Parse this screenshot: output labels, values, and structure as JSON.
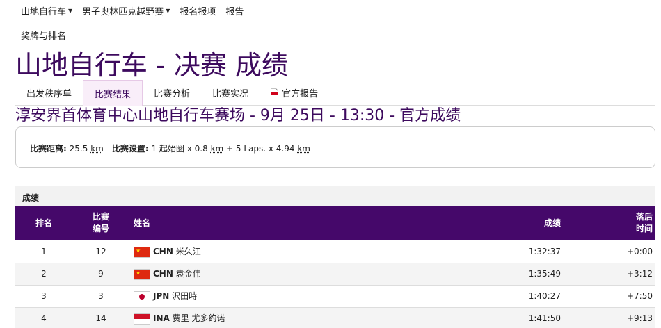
{
  "topnav": {
    "items": [
      {
        "label": "山地自行车",
        "dropdown": true
      },
      {
        "label": "男子奥林匹克越野赛",
        "dropdown": true
      },
      {
        "label": "报名报项",
        "dropdown": false
      },
      {
        "label": "报告",
        "dropdown": false
      }
    ],
    "sub_item": "奖牌与排名"
  },
  "page_title": "山地自行车 - 决赛 成绩",
  "tabs": [
    {
      "label": "出发秩序单",
      "active": false
    },
    {
      "label": "比赛结果",
      "active": true
    },
    {
      "label": "比赛分析",
      "active": false
    },
    {
      "label": "比赛实况",
      "active": false
    },
    {
      "label": "官方报告",
      "active": false,
      "icon": "pdf-icon"
    }
  ],
  "venue_line": "淳安界首体育中心山地自行车赛场 - 9月 25日 - 13:30 - 官方成绩",
  "info": {
    "distance_label": "比赛距离:",
    "distance_value": "25.5",
    "distance_unit": "km",
    "sep1": "-",
    "setup_label": "比赛设置:",
    "setup_text1": "1 起始圈 x 0.8",
    "setup_unit1": "km",
    "setup_text2": "+  5 Laps. x 4.94",
    "setup_unit2": "km"
  },
  "results": {
    "section_title": "成绩",
    "headers": {
      "rank": "排名",
      "bib_line1": "比赛",
      "bib_line2": "编号",
      "name": "姓名",
      "result": "成绩",
      "gap_line1": "落后",
      "gap_line2": "时间"
    },
    "rows": [
      {
        "rank": "1",
        "bib": "12",
        "flag": "chn",
        "noc": "CHN",
        "name": "米久江",
        "result": "1:32:37",
        "gap": "+0:00"
      },
      {
        "rank": "2",
        "bib": "9",
        "flag": "chn",
        "noc": "CHN",
        "name": "袁金伟",
        "result": "1:35:49",
        "gap": "+3:12"
      },
      {
        "rank": "3",
        "bib": "3",
        "flag": "jpn",
        "noc": "JPN",
        "name": "沢田時",
        "result": "1:40:27",
        "gap": "+7:50"
      },
      {
        "rank": "4",
        "bib": "14",
        "flag": "ina",
        "noc": "INA",
        "name": "费里 尤多约诺",
        "result": "1:41:50",
        "gap": "+9:13"
      }
    ]
  }
}
